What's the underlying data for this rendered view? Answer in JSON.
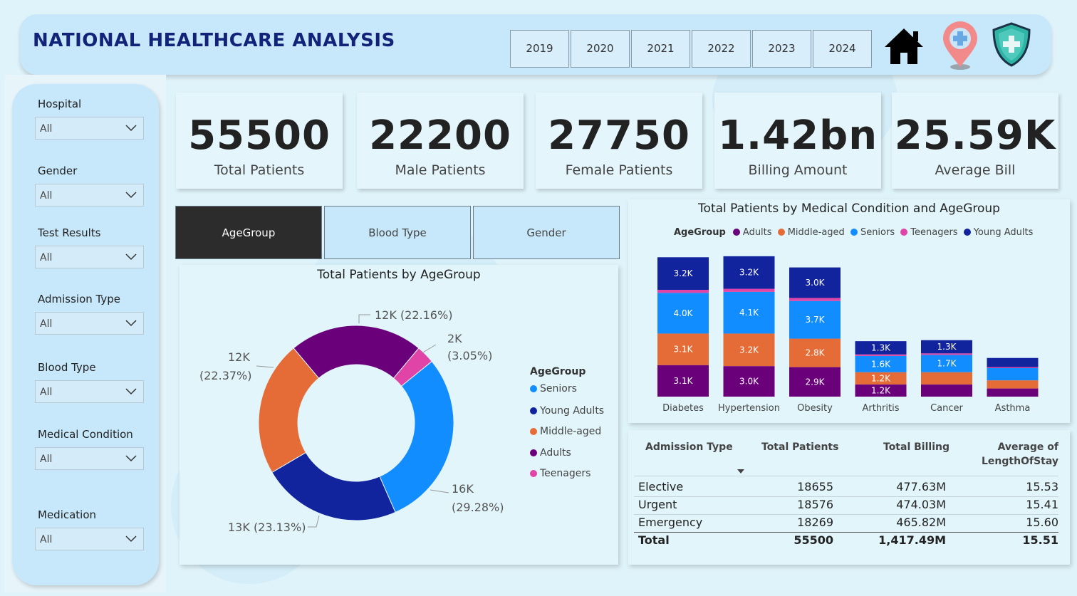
{
  "header": {
    "title": "NATIONAL HEALTHCARE ANALYSIS",
    "years": [
      "2019",
      "2020",
      "2021",
      "2022",
      "2023",
      "2024"
    ],
    "icons": [
      "home-icon",
      "location-plus-icon",
      "shield-plus-icon"
    ]
  },
  "filters": [
    {
      "label": "Hospital",
      "value": "All"
    },
    {
      "label": "Gender",
      "value": "All"
    },
    {
      "label": "Test Results",
      "value": "All"
    },
    {
      "label": "Admission Type",
      "value": "All"
    },
    {
      "label": "Blood Type",
      "value": "All"
    },
    {
      "label": "Medical Condition",
      "value": "All"
    },
    {
      "label": "Medication",
      "value": "All"
    }
  ],
  "kpis": [
    {
      "value": "55500",
      "label": "Total Patients"
    },
    {
      "value": "22200",
      "label": "Male Patients"
    },
    {
      "value": "27750",
      "label": "Female Patients"
    },
    {
      "value": "1.42bn",
      "label": "Billing Amount"
    },
    {
      "value": "25.59K",
      "label": "Average Bill"
    }
  ],
  "tabs": [
    "AgeGroup",
    "Blood Type",
    "Gender"
  ],
  "colors": {
    "Seniors": "#118dff",
    "Young Adults": "#12239e",
    "Middle-aged": "#e66c37",
    "Adults": "#6b007b",
    "Teenagers": "#e044a7"
  },
  "chart_data": [
    {
      "type": "pie",
      "title": "Total Patients by AgeGroup",
      "legend_title": "AgeGroup",
      "legend": [
        "Seniors",
        "Young Adults",
        "Middle-aged",
        "Adults",
        "Teenagers"
      ],
      "slices": [
        {
          "name": "Seniors",
          "value": 16,
          "percent": 29.28,
          "label": "16K",
          "pct_label": "(29.28%)"
        },
        {
          "name": "Young Adults",
          "value": 13,
          "percent": 23.13,
          "label": "13K (23.13%)"
        },
        {
          "name": "Middle-aged",
          "value": 12,
          "percent": 22.37,
          "label": "12K",
          "pct_label": "(22.37%)"
        },
        {
          "name": "Adults",
          "value": 12,
          "percent": 22.16,
          "label": "12K (22.16%)"
        },
        {
          "name": "Teenagers",
          "value": 2,
          "percent": 3.05,
          "label": "2K",
          "pct_label": "(3.05%)"
        }
      ]
    },
    {
      "type": "bar",
      "stacked": true,
      "title": "Total Patients by Medical Condition and AgeGroup",
      "legend_title": "AgeGroup",
      "legend": [
        "Adults",
        "Middle-aged",
        "Seniors",
        "Teenagers",
        "Young Adults"
      ],
      "categories": [
        "Diabetes",
        "Hypertension",
        "Obesity",
        "Arthritis",
        "Cancer",
        "Asthma"
      ],
      "series": [
        {
          "name": "Adults",
          "values": [
            3.1,
            3.0,
            2.9,
            1.2,
            1.2,
            0.8
          ],
          "labels": [
            "3.1K",
            "3.0K",
            "2.9K",
            "1.2K",
            "",
            ""
          ]
        },
        {
          "name": "Middle-aged",
          "values": [
            3.1,
            3.2,
            2.8,
            1.2,
            1.2,
            0.8
          ],
          "labels": [
            "3.1K",
            "3.2K",
            "2.8K",
            "1.2K",
            "",
            ""
          ]
        },
        {
          "name": "Seniors",
          "values": [
            4.0,
            4.1,
            3.7,
            1.6,
            1.7,
            1.2
          ],
          "labels": [
            "4.0K",
            "4.1K",
            "3.7K",
            "1.6K",
            "1.7K",
            ""
          ]
        },
        {
          "name": "Teenagers",
          "values": [
            0.3,
            0.3,
            0.3,
            0.15,
            0.15,
            0.1
          ],
          "labels": [
            "",
            "",
            "",
            "",
            "",
            ""
          ]
        },
        {
          "name": "Young Adults",
          "values": [
            3.2,
            3.2,
            3.0,
            1.3,
            1.3,
            0.9
          ],
          "labels": [
            "3.2K",
            "3.2K",
            "3.0K",
            "1.3K",
            "1.3K",
            ""
          ]
        }
      ],
      "ylim": [
        0,
        14
      ]
    }
  ],
  "table": {
    "headers": [
      "Admission Type",
      "Total Patients",
      "Total Billing",
      "Average of",
      "LengthOfStay"
    ],
    "rows": [
      [
        "Elective",
        "18655",
        "477.63M",
        "15.53"
      ],
      [
        "Urgent",
        "18576",
        "474.03M",
        "15.41"
      ],
      [
        "Emergency",
        "18269",
        "465.82M",
        "15.60"
      ]
    ],
    "total": [
      "Total",
      "55500",
      "1,417.49M",
      "15.51"
    ]
  }
}
